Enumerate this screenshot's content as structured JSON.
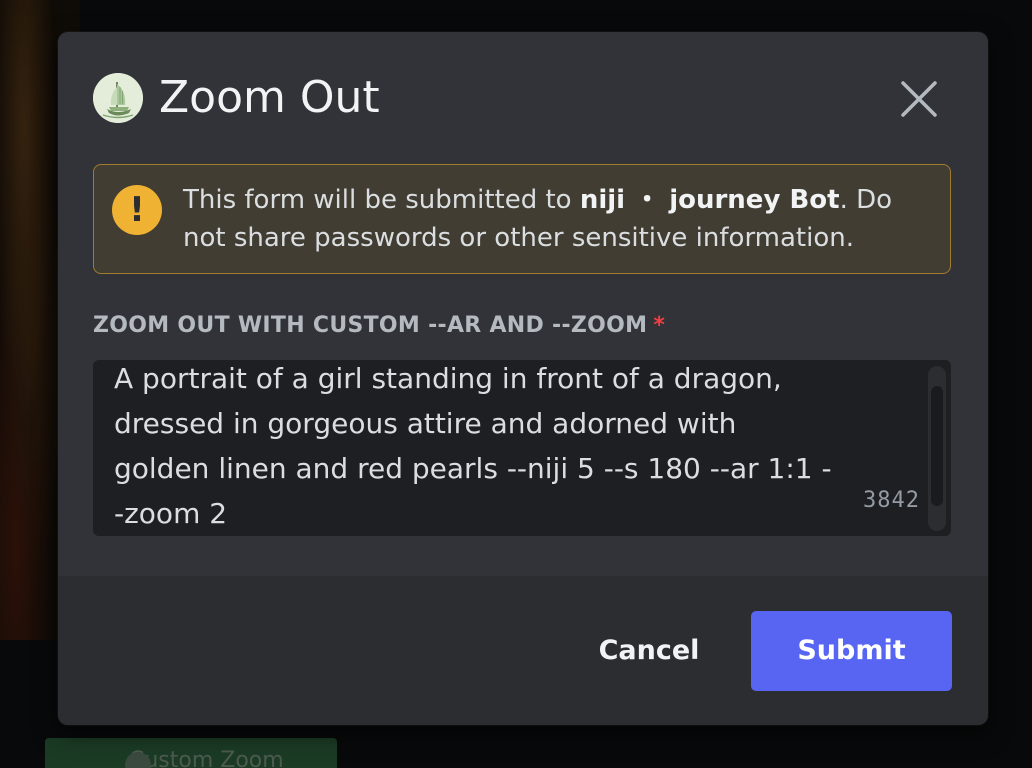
{
  "background": {
    "chip_label": "Custom Zoom"
  },
  "modal": {
    "title": "Zoom Out",
    "close_icon": "close-icon",
    "bot_avatar_icon": "junk-boat-avatar",
    "notice": {
      "icon": "warning-icon",
      "icon_glyph": "!",
      "text_before": "This form will be submitted to ",
      "bot_name": "niji ・ journey Bot",
      "text_after": ". Do not share passwords or other sensitive information."
    },
    "field": {
      "label": "ZOOM OUT WITH CUSTOM --AR AND --ZOOM",
      "required_marker": "*",
      "value": "A portrait of a girl standing in front of a dragon, dressed in gorgeous attire and adorned with golden linen and red pearls --niji 5 --s 180 --ar 1:1 --zoom 2",
      "char_counter": "3842"
    },
    "footer": {
      "cancel_label": "Cancel",
      "submit_label": "Submit"
    }
  },
  "colors": {
    "modal_bg": "#313338",
    "footer_bg": "#2b2d31",
    "submit_bg": "#5865f2",
    "warning": "#f0b232",
    "required": "#f23f42"
  }
}
